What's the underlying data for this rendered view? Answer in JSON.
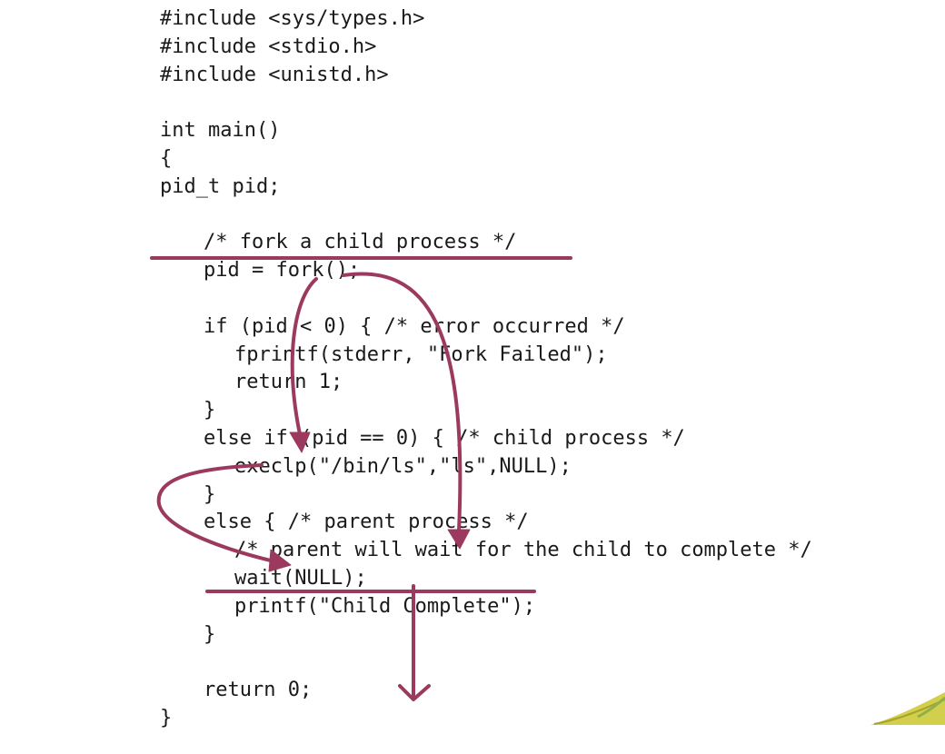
{
  "code": {
    "lines": [
      "#include <sys/types.h>",
      "#include <stdio.h>",
      "#include <unistd.h>",
      "",
      "int main()",
      "{",
      "pid_t pid;",
      "",
      "/* fork a child process */",
      "pid = fork();",
      "",
      "if (pid < 0) { /* error occurred */",
      "fprintf(stderr, \"Fork Failed\");",
      "return 1;",
      "}",
      "else if (pid == 0) { /* child process */",
      "execlp(\"/bin/ls\",\"ls\",NULL);",
      "}",
      "else { /* parent process */",
      "/* parent will wait for the child to complete */",
      "wait(NULL);",
      "printf(\"Child Complete\");",
      "}",
      "",
      "return 0;",
      "}"
    ]
  },
  "annotation_color": "#9b3a5e",
  "decoration": {
    "corner_shape": "yellow-green-leaf"
  }
}
